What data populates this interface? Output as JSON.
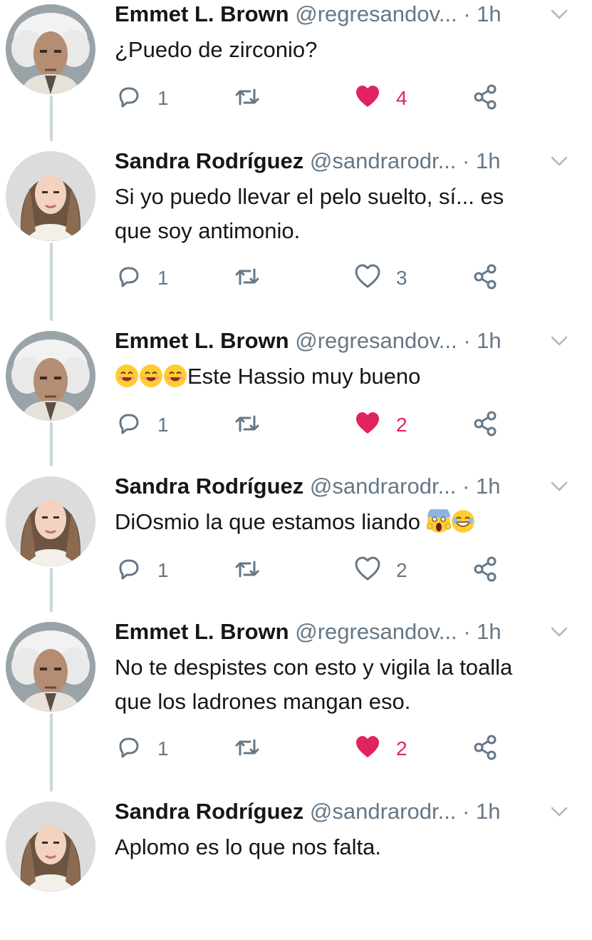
{
  "tweets": [
    {
      "name": "Emmet L. Brown",
      "handle": "@regresandov...",
      "time": "1h",
      "avatar": "emmet",
      "text_lines": [
        "¿Puedo de zirconio?"
      ],
      "replies": "1",
      "likes": "4",
      "liked": true
    },
    {
      "name": "Sandra Rodríguez",
      "handle": "@sandrarodr...",
      "time": "1h",
      "avatar": "sandra",
      "text_lines": [
        "Si yo puedo llevar el pelo suelto, sí... es",
        "que soy antimonio."
      ],
      "replies": "1",
      "likes": "3",
      "liked": false
    },
    {
      "name": "Emmet L. Brown",
      "handle": "@regresandov...",
      "time": "1h",
      "avatar": "emmet",
      "text_prefix_emojis": [
        "smiling-face-emoji",
        "smiling-face-emoji",
        "smiling-face-emoji"
      ],
      "text_lines": [
        "Este Hassio muy bueno"
      ],
      "replies": "1",
      "likes": "2",
      "liked": true
    },
    {
      "name": "Sandra Rodríguez",
      "handle": "@sandrarodr...",
      "time": "1h",
      "avatar": "sandra",
      "text_lines": [
        "DiOsmio la que estamos liando"
      ],
      "text_suffix_emojis": [
        "screaming-face-emoji",
        "laughing-face-emoji"
      ],
      "replies": "1",
      "likes": "2",
      "liked": false
    },
    {
      "name": "Emmet L. Brown",
      "handle": "@regresandov...",
      "time": "1h",
      "avatar": "emmet",
      "text_lines": [
        "No te despistes con esto y vigila la toalla",
        "que los ladrones mangan eso."
      ],
      "replies": "1",
      "likes": "2",
      "liked": true
    },
    {
      "name": "Sandra Rodríguez",
      "handle": "@sandrarodr...",
      "time": "1h",
      "avatar": "sandra",
      "text_lines": [
        "Aplomo es lo que nos falta."
      ]
    }
  ],
  "separator": "·",
  "icons": {
    "reply": "reply-icon",
    "retweet": "retweet-icon",
    "like": "heart-icon",
    "share": "share-icon",
    "caret": "chevron-down-icon"
  },
  "colors": {
    "like_active": "#e0245e",
    "muted": "#657786",
    "thread_line": "#ccd6dd",
    "text": "#14171a"
  }
}
